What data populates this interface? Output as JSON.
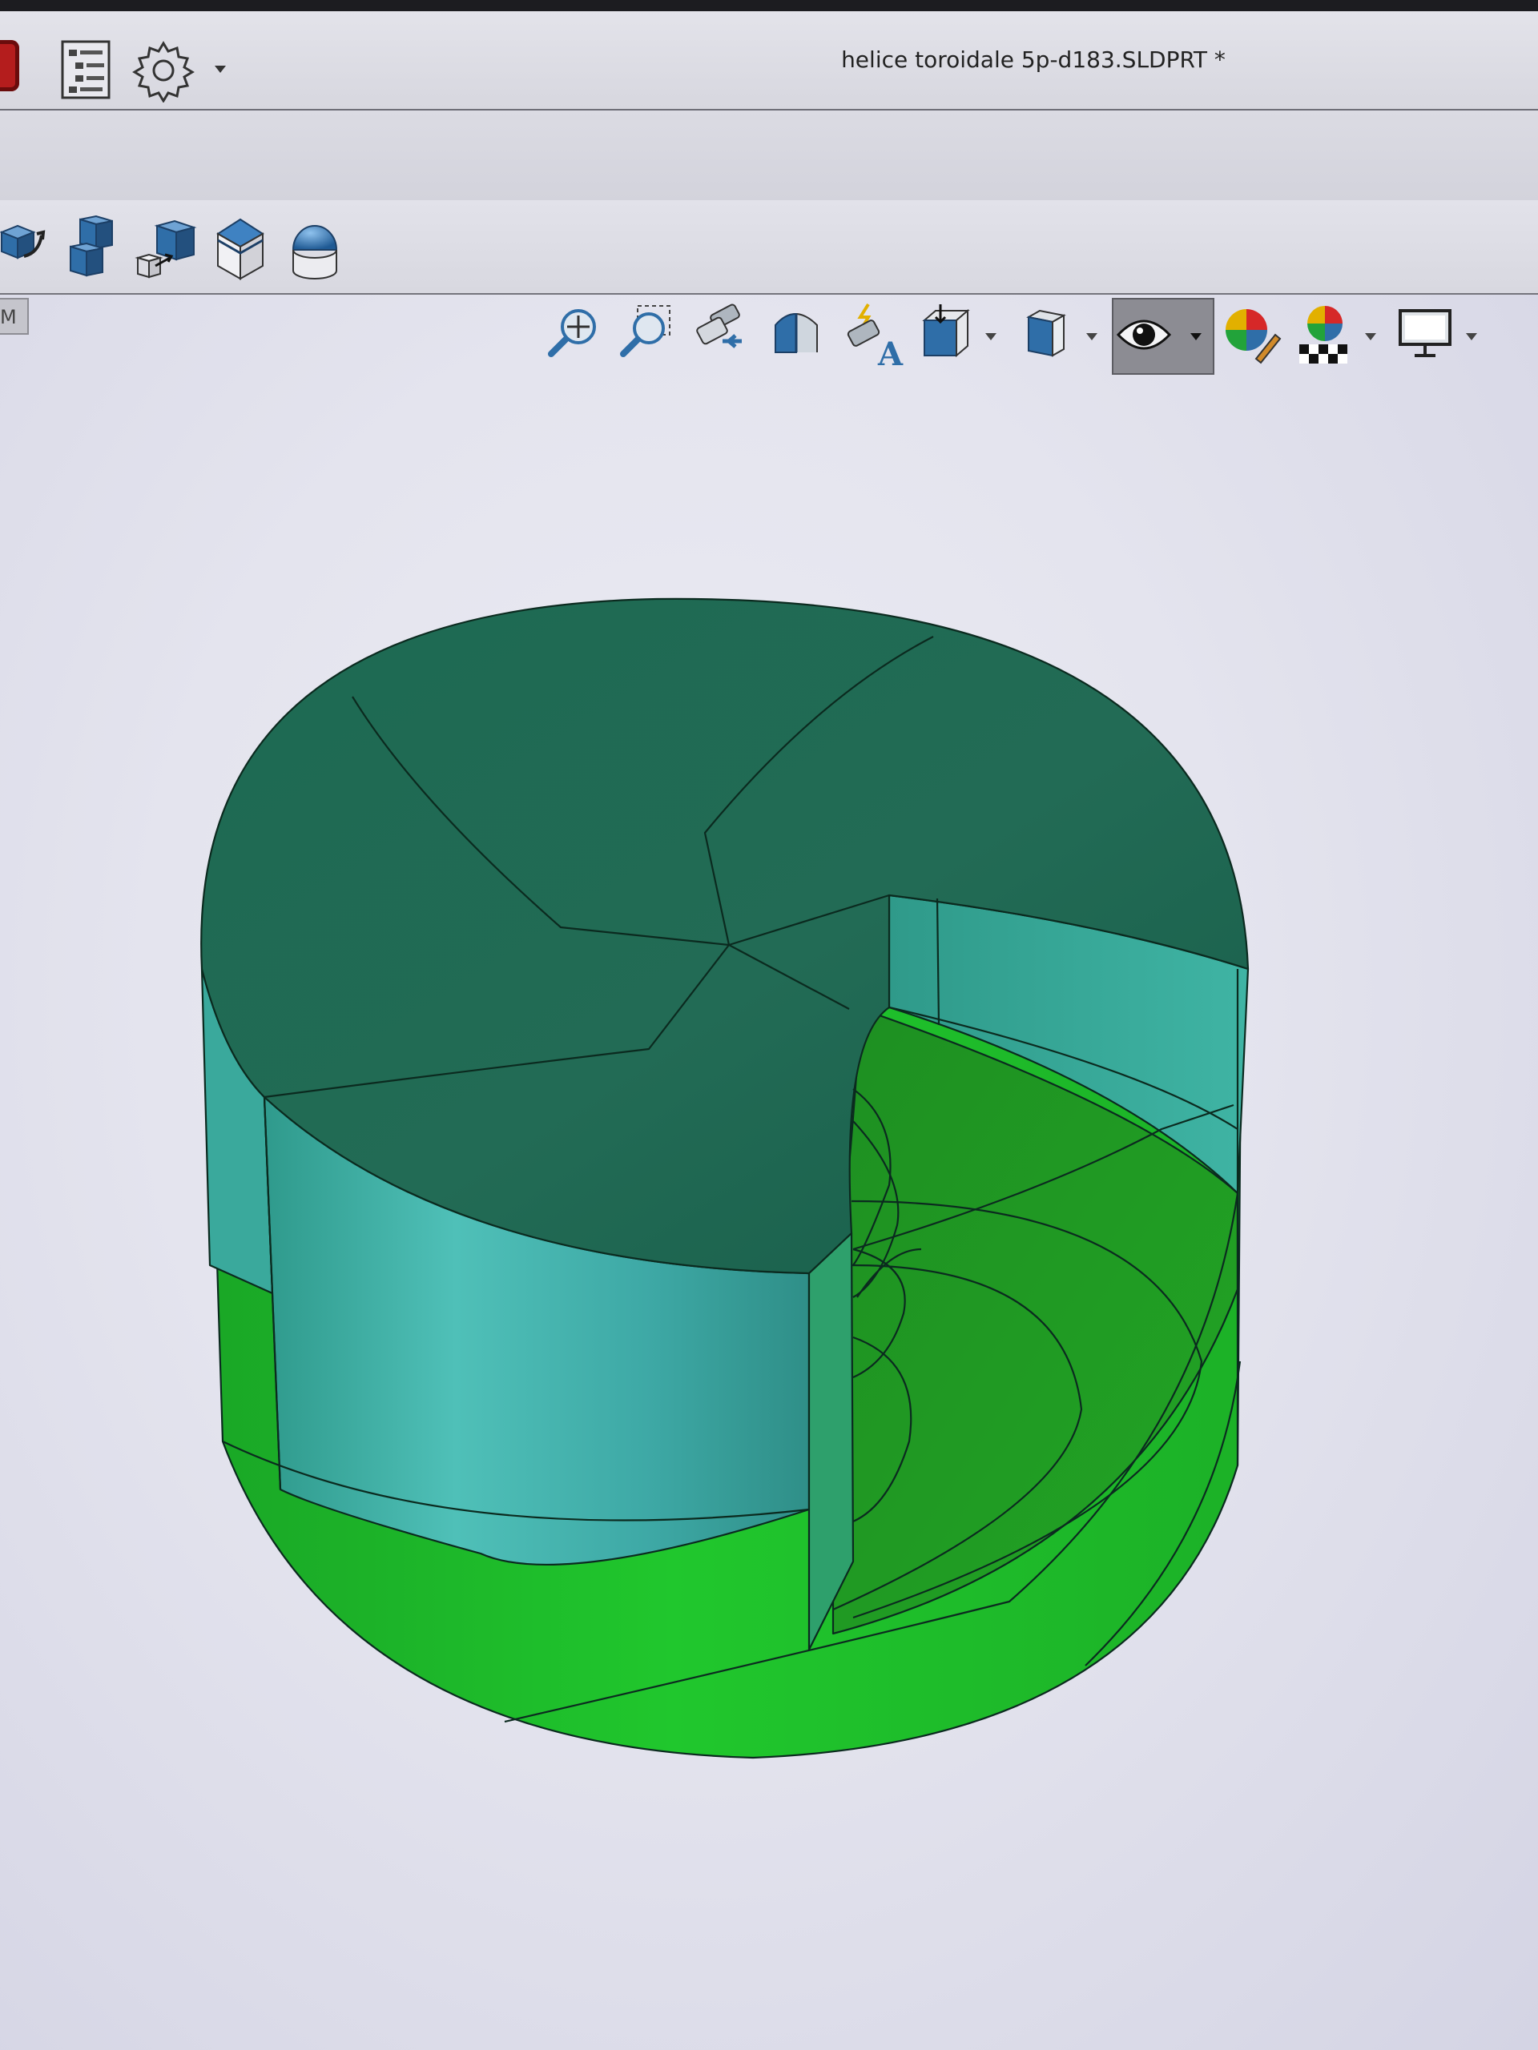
{
  "window": {
    "title": "helice toroidale 5p-d183.SLDPRT *"
  },
  "quick_access": [
    {
      "name": "featuremanager-tree-icon"
    },
    {
      "name": "options-gear-icon"
    },
    {
      "name": "options-dropdown-chevron-icon"
    }
  ],
  "command_bar": [
    {
      "name": "move-copy-bodies-icon"
    },
    {
      "name": "combine-bodies-icon"
    },
    {
      "name": "intersect-bodies-icon"
    },
    {
      "name": "wrap-icon"
    },
    {
      "name": "dome-icon"
    }
  ],
  "tab_stub": {
    "label": "M"
  },
  "heads_up_toolbar": [
    {
      "name": "zoom-to-fit-icon",
      "dropdown": false,
      "active": false
    },
    {
      "name": "zoom-to-area-icon",
      "dropdown": false,
      "active": false
    },
    {
      "name": "previous-view-icon",
      "dropdown": false,
      "active": false
    },
    {
      "name": "section-view-icon",
      "dropdown": false,
      "active": false
    },
    {
      "name": "dynamic-annotation-views-icon",
      "dropdown": false,
      "active": false
    },
    {
      "name": "view-orientation-icon",
      "dropdown": true,
      "active": false
    },
    {
      "name": "display-style-icon",
      "dropdown": true,
      "active": false
    },
    {
      "name": "hide-show-items-icon",
      "dropdown": true,
      "active": true
    },
    {
      "name": "edit-appearance-icon",
      "dropdown": false,
      "active": false
    },
    {
      "name": "apply-scene-icon",
      "dropdown": true,
      "active": false
    },
    {
      "name": "view-settings-icon",
      "dropdown": true,
      "active": false
    }
  ],
  "colors": {
    "top_face": "#1f6b56",
    "cut_side_face": "#48b8b0",
    "bright_green": "#1fc42c",
    "mid_green": "#22a322",
    "edge": "#0b2a1f",
    "toolbar_blue": "#2f6ea8",
    "active_button": "#8c8c93"
  }
}
